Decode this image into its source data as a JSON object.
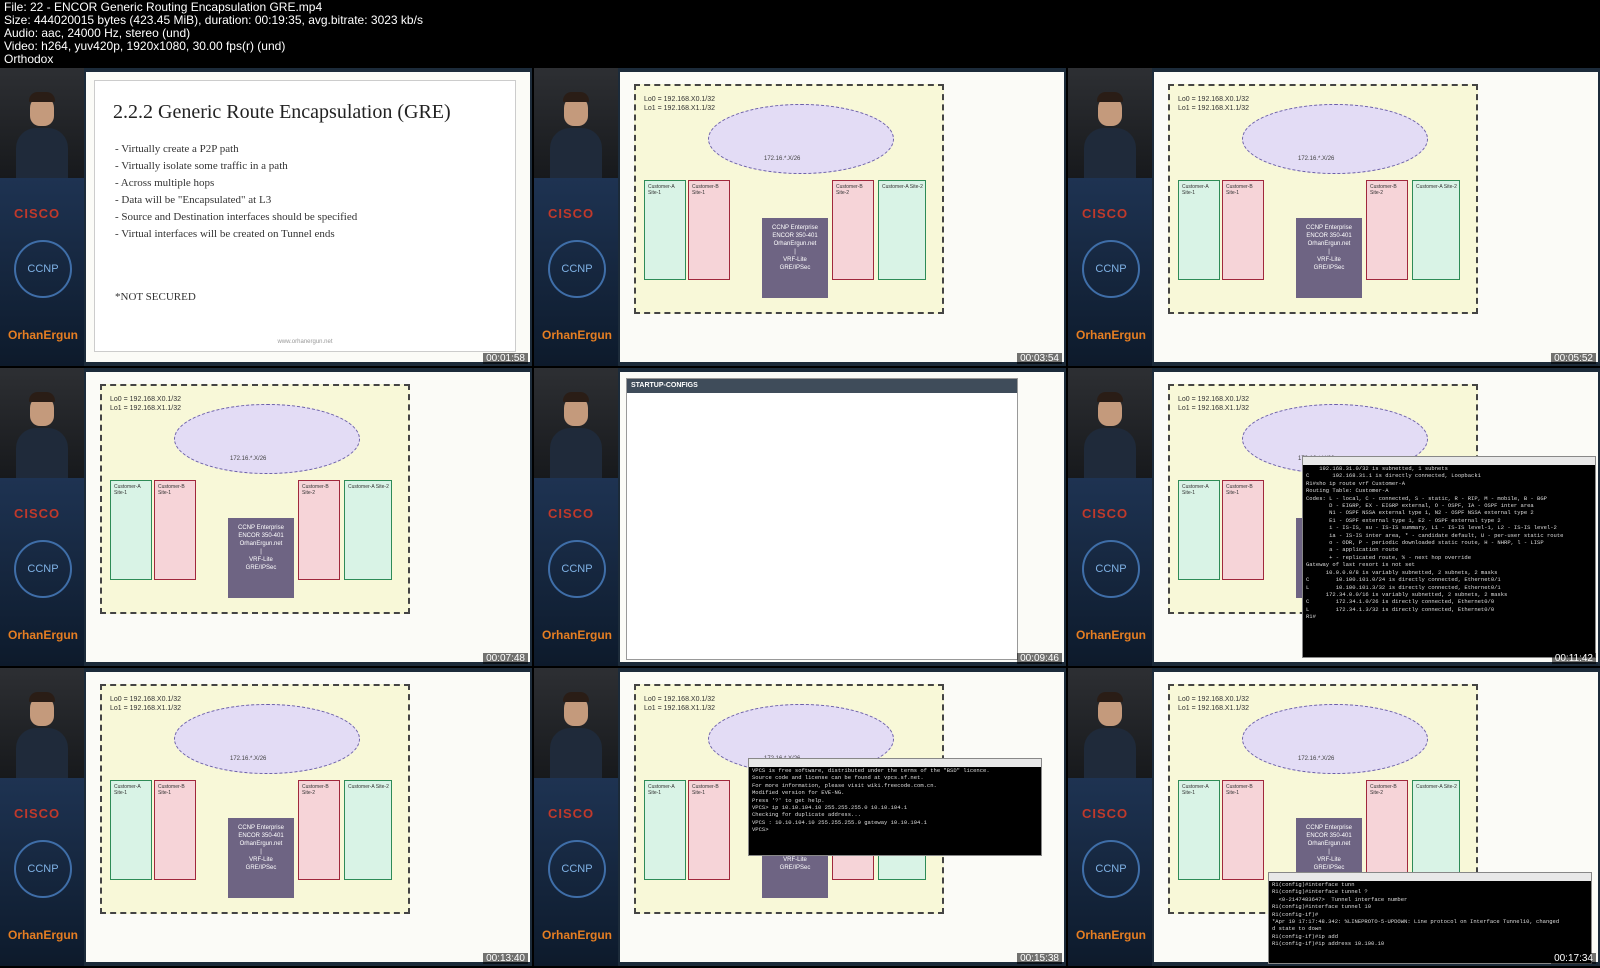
{
  "header": {
    "file_line": "File: 22 - ENCOR Generic Routing Encapsulation GRE.mp4",
    "size_line": "Size: 444020015 bytes (423.45 MiB), duration: 00:19:35, avg.bitrate: 3023 kb/s",
    "audio_line": "Audio: aac, 24000 Hz, stereo (und)",
    "video_line": "Video: h264, yuv420p, 1920x1080, 30.00 fps(r) (und)",
    "tag_line": "Orthodox"
  },
  "sidebar": {
    "cisco": "CISCO",
    "ccnp": "CCNP",
    "brand": "OrhanErgun"
  },
  "slide": {
    "title": "2.2.2 Generic Route Encapsulation (GRE)",
    "bullets": [
      "- Virtually create a P2P path",
      "- Virtually isolate some traffic in a path",
      "- Across multiple hops",
      "- Data will be \"Encapsulated\" at L3",
      "- Source and Destination interfaces should be specified",
      "- Virtual interfaces will be created on Tunnel ends"
    ],
    "note": "*NOT SECURED",
    "footer": "www.orhanergun.net"
  },
  "topology": {
    "lo0": "Lo0 = 192.168.X0.1/32",
    "lo1": "Lo1 = 192.168.X1.1/32",
    "subnet": "172.16.*.X/26",
    "box_lines": [
      "CCNP Enterprise",
      "ENCOR 350-401",
      "OrhanErgun.net",
      "|",
      "VRF-Lite",
      "GRE/IPSec"
    ],
    "site_a1": "Customer-A Site-1",
    "site_b1": "Customer-B Site-1",
    "site_b2": "Customer-B Site-2",
    "site_a2": "Customer-A Site-2"
  },
  "startup_configs": {
    "title": "STARTUP-CONFIGS"
  },
  "terminal_routes": [
    "    192.168.31.0/32 is subnetted, 1 subnets",
    "C       192.168.31.1 is directly connected, Loopback1",
    "R1#sho ip route vrf Customer-A",
    "",
    "Routing Table: Customer-A",
    "Codes: L - local, C - connected, S - static, R - RIP, M - mobile, B - BGP",
    "       D - EIGRP, EX - EIGRP external, O - OSPF, IA - OSPF inter area",
    "       N1 - OSPF NSSA external type 1, N2 - OSPF NSSA external type 2",
    "       E1 - OSPF external type 1, E2 - OSPF external type 2",
    "       i - IS-IS, su - IS-IS summary, L1 - IS-IS level-1, L2 - IS-IS level-2",
    "       ia - IS-IS inter area, * - candidate default, U - per-user static route",
    "       o - ODR, P - periodic downloaded static route, H - NHRP, l - LISP",
    "       a - application route",
    "       + - replicated route, % - next hop override",
    "",
    "Gateway of last resort is not set",
    "",
    "      10.0.0.0/8 is variably subnetted, 2 subnets, 2 masks",
    "C        10.100.101.0/24 is directly connected, Ethernet0/1",
    "L        10.100.101.3/32 is directly connected, Ethernet0/1",
    "      172.34.0.0/16 is variably subnetted, 2 subnets, 2 masks",
    "C        172.34.1.0/26 is directly connected, Ethernet0/0",
    "L        172.34.1.3/32 is directly connected, Ethernet0/0",
    "R1#"
  ],
  "terminal_vpcs": [
    "VPCS is free software, distributed under the terms of the \"BSD\" licence.",
    "Source code and license can be found at vpcs.sf.net.",
    "For more information, please visit wiki.freecode.com.cn.",
    "Modified version for EVE-NG.",
    "",
    "Press '?' to get help.",
    "",
    "VPCS> ip 10.10.104.10 255.255.255.0 10.10.104.1",
    "Checking for duplicate address...",
    "VPCS : 10.10.104.10 255.255.255.0 gateway 10.10.104.1",
    "",
    "VPCS> "
  ],
  "terminal_tunnel": [
    "R1(config)#interface tunn",
    "R1(config)#interface tunnel ?",
    "  <0-2147483647>  Tunnel interface number",
    "",
    "R1(config)#interface tunnel 10",
    "R1(config-if)#",
    "*Apr 10 17:17:48.342: %LINEPROTO-5-UPDOWN: Line protocol on Interface Tunnel10, changed",
    "d state to down",
    "R1(config-if)#ip add",
    "R1(config-if)#ip address 10.100.10"
  ],
  "timestamps": [
    "00:01:58",
    "00:03:54",
    "00:05:52",
    "00:07:48",
    "00:09:46",
    "00:11:42",
    "00:13:40",
    "00:15:38",
    "00:17:34"
  ]
}
